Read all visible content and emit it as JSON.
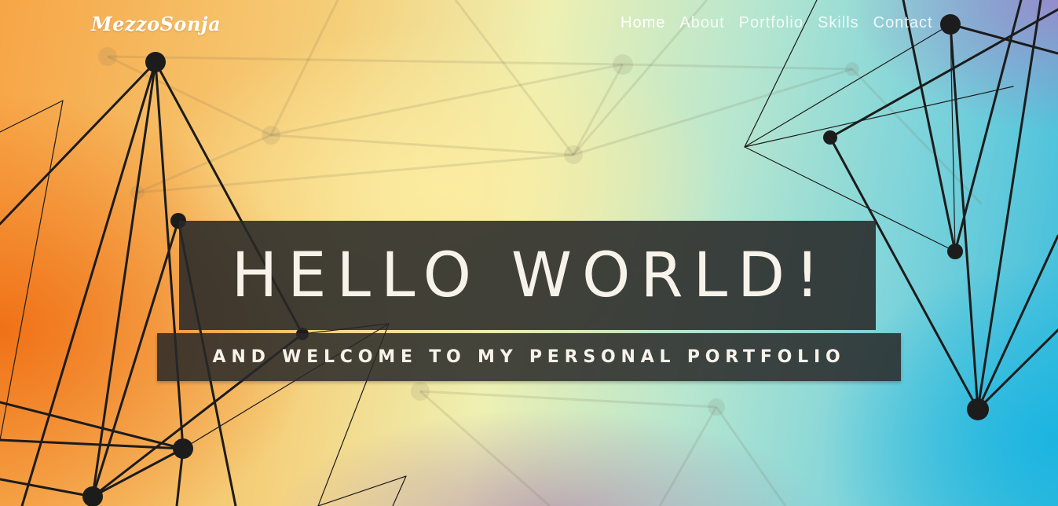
{
  "brand": {
    "logo": "MezzoSonja"
  },
  "nav": {
    "items": [
      {
        "label": "Home",
        "active": true
      },
      {
        "label": "About",
        "active": false
      },
      {
        "label": "Portfolio",
        "active": false
      },
      {
        "label": "Skills",
        "active": false
      },
      {
        "label": "Contact",
        "active": false
      }
    ]
  },
  "hero": {
    "title": "HELLO WORLD!",
    "subtitle": "AND WELCOME TO MY PERSONAL PORTFOLIO"
  },
  "colors": {
    "overlay": "#282828",
    "text": "#f8f3ea",
    "network": "#1c1c1c",
    "warm": "#f07a1a",
    "cool": "#19b4e1"
  }
}
